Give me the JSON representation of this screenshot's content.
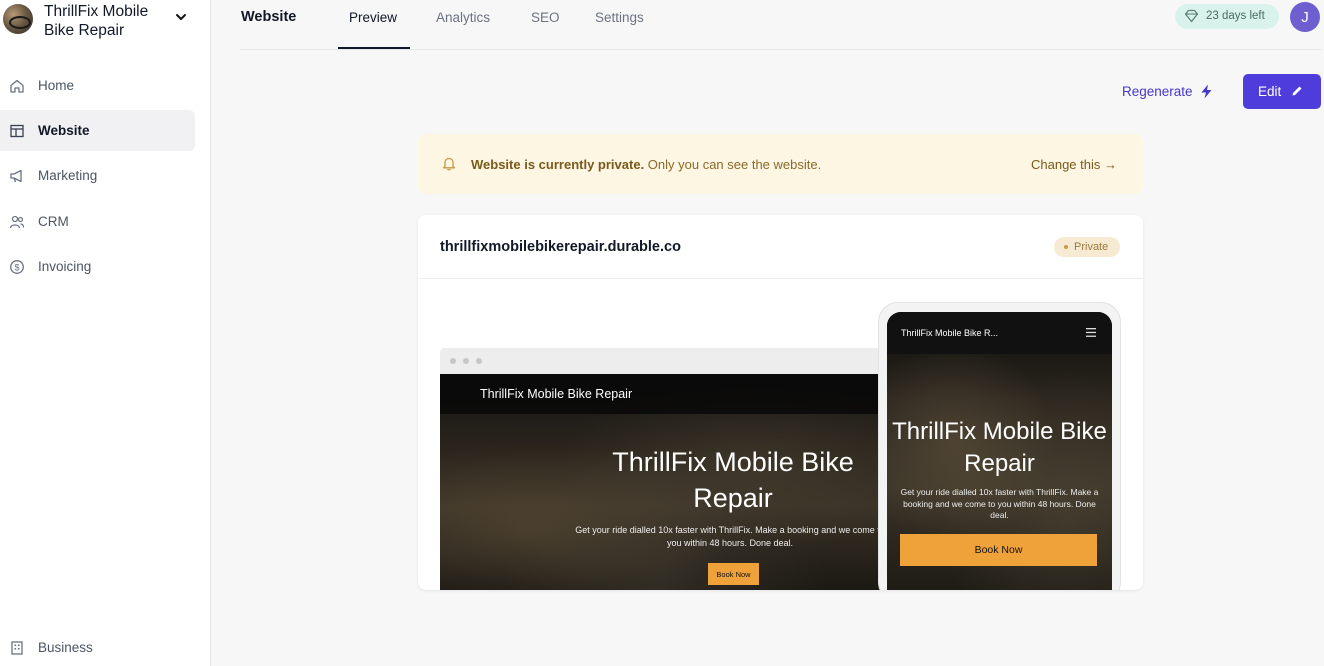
{
  "sidebar": {
    "brand_name": "ThrillFix Mobile Bike Repair",
    "items": [
      {
        "label": "Home",
        "icon": "home-icon"
      },
      {
        "label": "Website",
        "icon": "website-icon"
      },
      {
        "label": "Marketing",
        "icon": "megaphone-icon"
      },
      {
        "label": "CRM",
        "icon": "users-icon"
      },
      {
        "label": "Invoicing",
        "icon": "dollar-icon"
      }
    ],
    "bottom_item": {
      "label": "Business",
      "icon": "building-icon"
    },
    "active_item": "Website"
  },
  "header": {
    "title": "Website",
    "tabs": [
      {
        "label": "Preview",
        "active": true
      },
      {
        "label": "Analytics",
        "active": false
      },
      {
        "label": "SEO",
        "active": false
      },
      {
        "label": "Settings",
        "active": false
      }
    ],
    "trial_text": "23 days left",
    "user_initial": "J"
  },
  "actions": {
    "regenerate_label": "Regenerate",
    "edit_label": "Edit"
  },
  "banner": {
    "bold_text": "Website is currently private.",
    "text": " Only you can see the website.",
    "link_text": "Change this →"
  },
  "site": {
    "domain": "thrillfixmobilebikerepair.durable.co",
    "status_badge": "Private",
    "desktop_preview": {
      "nav_title": "ThrillFix Mobile Bike Repair",
      "hero_title": "ThrillFix Mobile Bike Repair",
      "hero_subtitle": "Get your ride dialled 10x faster with ThrillFix. Make a booking and we come to you within 48 hours. Done deal.",
      "cta_label": "Book Now"
    },
    "mobile_preview": {
      "nav_title": "ThrillFix Mobile Bike R...",
      "hero_title": "ThrillFix Mobile Bike Repair",
      "hero_subtitle": "Get your ride dialled 10x faster with ThrillFix. Make a booking and we come to you within 48 hours. Done deal.",
      "cta_label": "Book Now"
    }
  },
  "colors": {
    "accent": "#4f3ddb",
    "link": "#4338ca",
    "banner_bg": "#fdf6e3",
    "cta_orange": "#f0a23a",
    "trial_bg": "#d9f3ec"
  }
}
